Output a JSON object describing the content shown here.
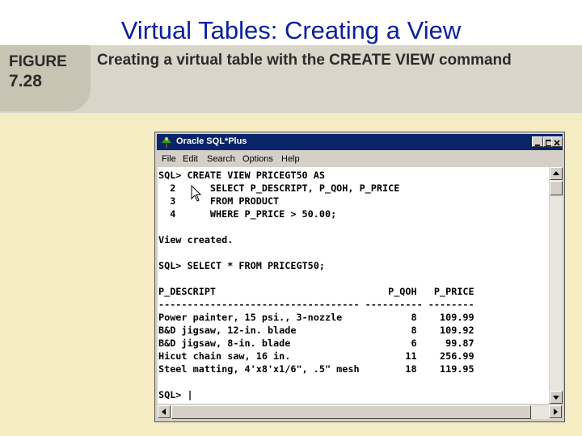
{
  "slide": {
    "title": "Virtual Tables: Creating a View",
    "figure_label": "FIGURE",
    "figure_number": "7.28",
    "figure_caption": "Creating a virtual table with the CREATE VIEW command"
  },
  "window": {
    "title": "Oracle SQL*Plus",
    "app_icon": "oracle-sqlplus-icon",
    "menu": [
      "File",
      "Edit",
      "Search",
      "Options",
      "Help"
    ],
    "controls": [
      "minimize",
      "maximize",
      "close"
    ]
  },
  "console": {
    "lines": [
      "SQL> CREATE VIEW PRICEGT50 AS",
      "  2      SELECT P_DESCRIPT, P_QOH, P_PRICE",
      "  3      FROM PRODUCT",
      "  4      WHERE P_PRICE > 50.00;",
      "",
      "View created.",
      "",
      "SQL> SELECT * FROM PRICEGT50;",
      "",
      "P_DESCRIPT                              P_QOH   P_PRICE",
      "----------------------------------- ---------- --------",
      "Power painter, 15 psi., 3-nozzle            8    109.99",
      "B&D jigsaw, 12-in. blade                    8    109.92",
      "B&D jigsaw, 8-in. blade                     6     99.87",
      "Hicut chain saw, 16 in.                    11    256.99",
      "Steel matting, 4'x8'x1/6\", .5\" mesh        18    119.95",
      "",
      "SQL> |"
    ]
  },
  "colors": {
    "title_blue": "#0a1f9e",
    "figure_band": "#d9d6c9",
    "content_background": "#f6ecc3",
    "titlebar": "#0a246a"
  }
}
